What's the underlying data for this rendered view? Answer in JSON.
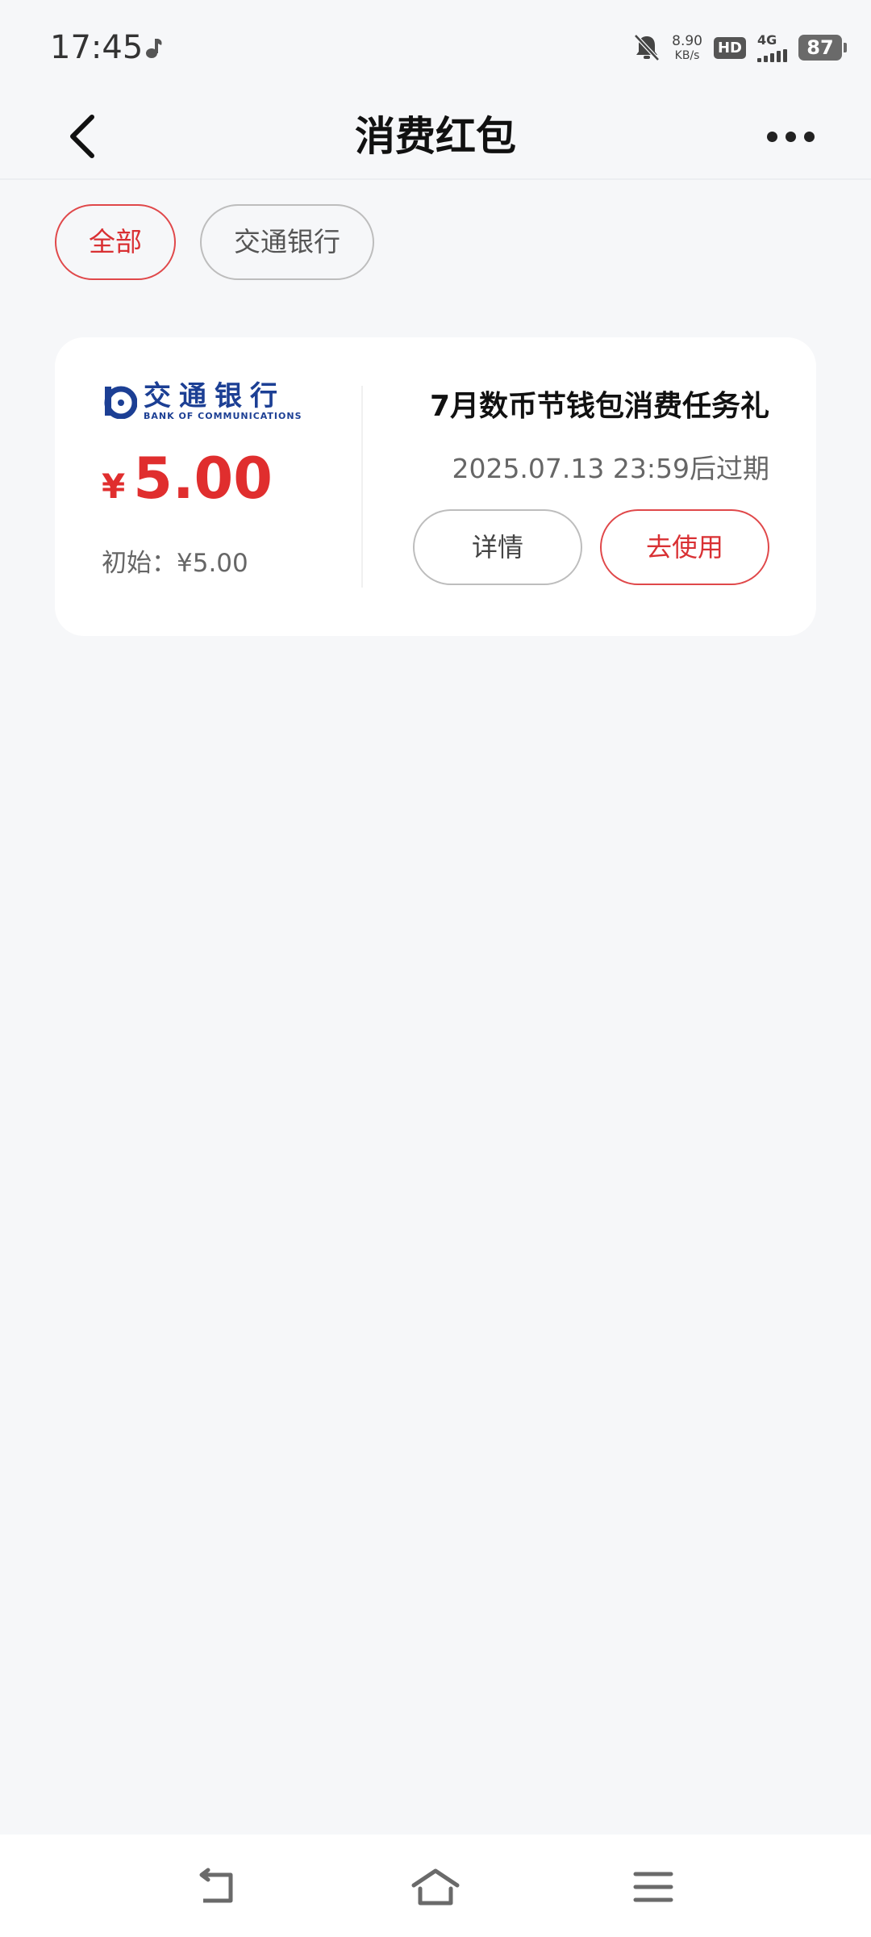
{
  "status_bar": {
    "time": "17:45",
    "speed_value": "8.90",
    "speed_unit": "KB/s",
    "hd_label": "HD",
    "network_label": "4G",
    "battery_level": "87"
  },
  "nav": {
    "title": "消费红包"
  },
  "filters": [
    {
      "label": "全部",
      "active": true
    },
    {
      "label": "交通银行",
      "active": false
    }
  ],
  "coupon": {
    "bank_logo_cn": "交通银行",
    "bank_logo_en": "BANK OF COMMUNICATIONS",
    "currency_symbol": "¥",
    "amount": "5.00",
    "initial_label": "初始：¥5.00",
    "title": "7月数币节钱包消费任务礼",
    "expire_text": "2025.07.13 23:59后过期",
    "detail_button": "详情",
    "use_button": "去使用"
  },
  "colors": {
    "accent_red": "#d93033",
    "bank_blue": "#1c3f94",
    "background": "#f6f7f9"
  },
  "icons": {
    "back": "chevron-left-icon",
    "more": "more-dots-icon",
    "sys_back": "back-icon",
    "sys_home": "home-icon",
    "sys_menu": "menu-icon"
  }
}
